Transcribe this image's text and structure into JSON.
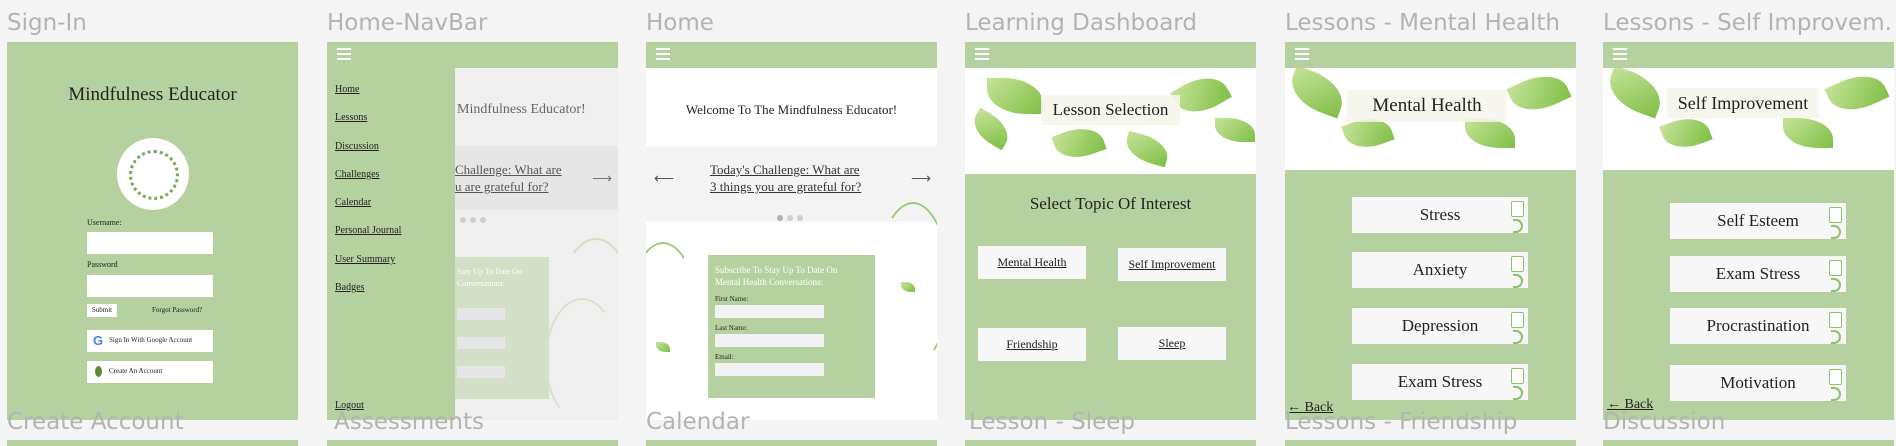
{
  "frames": {
    "signin": "Sign-In",
    "navbar": "Home-NavBar",
    "home": "Home",
    "dashboard": "Learning Dashboard",
    "mental": "Lessons - Mental Health",
    "selfimp": "Lessons - Self Improvem..."
  },
  "bottom_frames": [
    "Create Account",
    "Assessments",
    "Calendar",
    "Lesson - Sleep",
    "Lessons - Friendship",
    "Discussion"
  ],
  "signin": {
    "title": "Mindfulness Educator",
    "username_label": "Username:",
    "password_label": "Password",
    "submit": "Submit",
    "forgot": "Forgot Password?",
    "google": "Sign In With Google Account",
    "create": "Create An Account"
  },
  "navbar": {
    "items": [
      "Home",
      "Lessons",
      "Discussion",
      "Challenges",
      "Calendar",
      "Personal Journal",
      "User Summary",
      "Badges"
    ],
    "logout": "Logout",
    "bg_title": "Mindfulness Educator!",
    "bg_challenge_1": "Challenge: What are",
    "bg_challenge_2": "u are grateful for?",
    "bg_sub_1": "Stay Up To Date On",
    "bg_sub_2": "Conversations:"
  },
  "home": {
    "welcome": "Welcome To The Mindfulness Educator!",
    "challenge_1": "Today's Challenge: What are",
    "challenge_2": "3 things you are grateful for?",
    "sub_1": "Subscribe To Stay Up To Date On",
    "sub_2": "Mental Health Conversations:",
    "first_name": "First Name:",
    "last_name": "Last Name:",
    "email": "Email:"
  },
  "dashboard": {
    "banner": "Lesson Selection",
    "heading": "Select Topic Of Interest",
    "topics": [
      "Mental Health",
      "Self Improvement",
      "Friendship",
      "Sleep"
    ]
  },
  "mental": {
    "banner": "Mental Health",
    "items": [
      "Stress",
      "Anxiety",
      "Depression",
      "Exam Stress"
    ],
    "back": "← Back"
  },
  "selfimp": {
    "banner": "Self Improvement",
    "items": [
      "Self Esteem",
      "Exam Stress",
      "Procrastination",
      "Motivation"
    ],
    "back": "← Back"
  },
  "colors": {
    "green": "#b5d19f",
    "canvas": "#f4f4f4",
    "label": "#b3b3b3"
  },
  "icons": [
    "hamburger-menu-icon",
    "wreath-logo-icon",
    "google-g-icon",
    "leaf-icon",
    "arrow-left-icon",
    "arrow-right-icon",
    "document-icon",
    "ear-icon"
  ]
}
